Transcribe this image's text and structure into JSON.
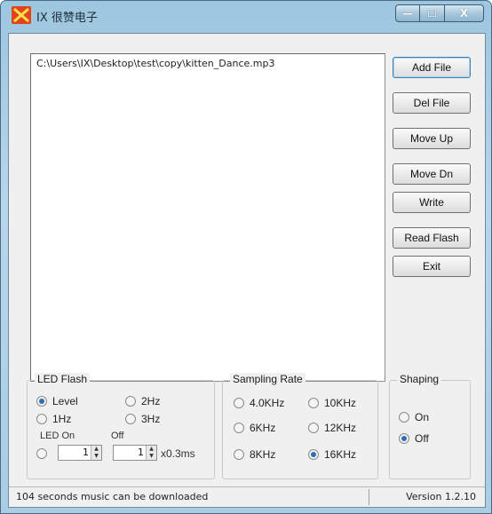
{
  "window": {
    "title": "IX 很赞电子",
    "caption_min": "—",
    "caption_max": "☐",
    "caption_close": "X"
  },
  "file_list": {
    "items": [
      "C:\\Users\\IX\\Desktop\\test\\copy\\kitten_Dance.mp3"
    ]
  },
  "buttons": {
    "add_file": "Add File",
    "del_file": "Del File",
    "move_up": "Move Up",
    "move_down": "Move Dn",
    "write": "Write",
    "read_flash": "Read Flash",
    "exit": "Exit"
  },
  "led_flash": {
    "label": "LED Flash",
    "options": {
      "level": "Level",
      "2hz": "2Hz",
      "1hz": "1Hz",
      "3hz": "3Hz"
    },
    "selected": "level",
    "led_on_label": "LED On",
    "off_label": "Off",
    "on_value": "1",
    "off_value": "1",
    "unit": "x0.3ms"
  },
  "sampling_rate": {
    "label": "Sampling Rate",
    "options": {
      "4khz": "4.0KHz",
      "10khz": "10KHz",
      "6khz": "6KHz",
      "12khz": "12KHz",
      "8khz": "8KHz",
      "16khz": "16KHz"
    },
    "selected": "16khz"
  },
  "shaping": {
    "label": "Shaping",
    "options": {
      "on": "On",
      "off": "Off"
    },
    "selected": "off"
  },
  "status": {
    "message": "104 seconds music can be downloaded",
    "version": "Version 1.2.10"
  }
}
